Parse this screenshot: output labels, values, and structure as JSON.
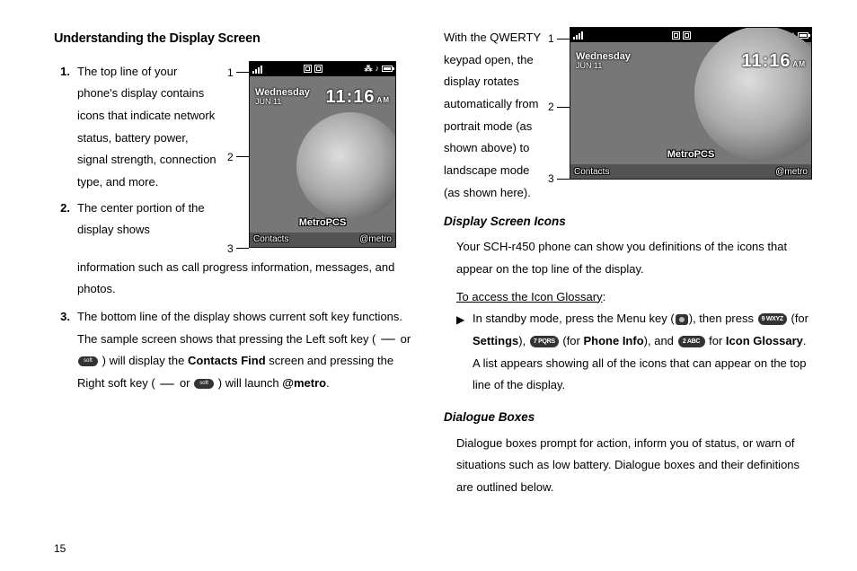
{
  "page_number": "15",
  "left": {
    "heading": "Understanding the Display Screen",
    "items": [
      "The top line of your phone's display contains icons that indicate network status, battery power, signal strength, connection type, and more.",
      "The center portion of the display shows",
      "The bottom line of the display shows current soft key functions. The sample screen shows that pressing the Left soft key ("
    ],
    "item2_cont": "information such as call progress information, messages, and photos.",
    "item3_mid_a": " or ",
    "item3_mid_b": ") will display the ",
    "item3_bold_a": "Contacts Find",
    "item3_mid_c": " screen and pressing the Right soft key (",
    "item3_mid_d": " or ",
    "item3_mid_e": ") will launch ",
    "item3_bold_b": "@metro",
    "item3_end": "."
  },
  "right": {
    "qwerty_text": "With the QWERTY keypad open, the display rotates automatically from portrait mode (as shown above) to landscape mode (as shown here).",
    "dsi_head": "Display Screen Icons",
    "dsi_body": "Your SCH-r450 phone can show you definitions of the icons that appear on the top line of the display.",
    "dsi_link": "To access the Icon Glossary",
    "dsi_step_a": "In standby mode, press the Menu key (",
    "dsi_step_b": "), then press ",
    "dsi_step_c": " (for ",
    "dsi_bold_settings": "Settings",
    "dsi_step_d": "), ",
    "dsi_step_e": " (for ",
    "dsi_bold_phoneinfo": "Phone Info",
    "dsi_step_f": "), and ",
    "dsi_step_g": " for ",
    "dsi_bold_iconglossary": "Icon Glossary",
    "dsi_step_h": ". A list appears showing all of the icons that can appear on the top line of the display.",
    "dlg_head": "Dialogue Boxes",
    "dlg_body": "Dialogue boxes prompt for action, inform you of status, or warn of situations such as low battery. Dialogue boxes and their definitions are outlined below."
  },
  "phone": {
    "dow": "Wednesday",
    "date": "JUN 11",
    "time": "11:16",
    "ampm": "AM",
    "carrier": "MetroPCS",
    "left_soft": "Contacts",
    "right_soft": "@metro"
  },
  "keys": {
    "k9": "9 WXYZ",
    "k7": "7 PQRS",
    "k2": "2 ABC",
    "soft": "soft"
  },
  "callouts": [
    "1",
    "2",
    "3"
  ]
}
